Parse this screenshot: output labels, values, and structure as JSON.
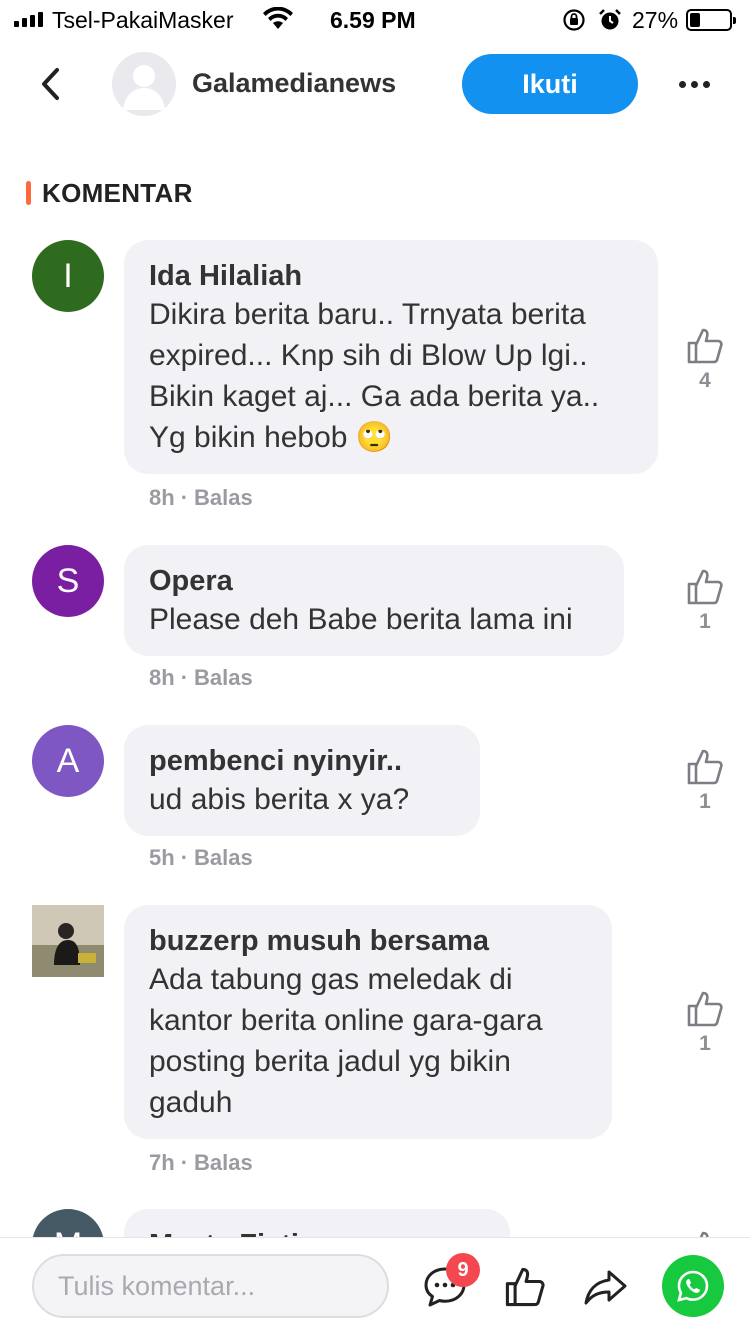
{
  "status_bar": {
    "carrier": "Tsel-PakaiMasker",
    "time": "6.59 PM",
    "battery_percent": "27%",
    "battery_level": 0.27,
    "icons": [
      "signal-icon",
      "wifi-icon",
      "rotation-lock-icon",
      "alarm-icon",
      "battery-icon"
    ]
  },
  "header": {
    "channel_name": "Galamedianews",
    "follow_label": "Ikuti",
    "icons": [
      "back-arrow-icon",
      "avatar-placeholder-icon",
      "more-icon"
    ]
  },
  "section": {
    "title": "KOMENTAR"
  },
  "comments": [
    {
      "initial": "I",
      "avatar_color": "#2e6b1f",
      "name": "Ida Hilaliah",
      "text": "Dikira berita baru.. Trnyata berita expired... Knp sih di Blow Up lgi.. Bikin kaget aj... Ga ada berita ya.. Yg bikin hebob 🙄",
      "time": "8h",
      "reply_label": "Balas",
      "likes": "4"
    },
    {
      "initial": "S",
      "avatar_color": "#7b1fa2",
      "name": "Opera",
      "text": "Please deh Babe berita lama ini",
      "time": "8h",
      "reply_label": "Balas",
      "likes": "1"
    },
    {
      "initial": "A",
      "avatar_color": "#7e57c2",
      "name": "pembenci nyinyir..",
      "text": "ud abis berita x ya?",
      "time": "5h",
      "reply_label": "Balas",
      "likes": "1"
    },
    {
      "initial": "",
      "avatar_color": "#d8d2c4",
      "name": "buzzerp musuh bersama",
      "text": "Ada tabung gas meledak di kantor berita online gara-gara posting berita jadul yg bikin gaduh",
      "time": "7h",
      "reply_label": "Balas",
      "likes": "1"
    },
    {
      "initial": "M",
      "avatar_color": "#455a64",
      "name": "Mayta Fiati",
      "text": "",
      "time": "",
      "reply_label": "",
      "likes": ""
    }
  ],
  "bottom_bar": {
    "input_placeholder": "Tulis komentar...",
    "comment_count_badge": "9",
    "icons": [
      "comment-icon",
      "like-icon",
      "share-icon",
      "whatsapp-icon"
    ],
    "whatsapp_color": "#17c93e"
  },
  "colors": {
    "accent": "#1391f0",
    "section_bar": "#ff6a3d",
    "bubble_bg": "#f2f2f6",
    "badge": "#f5474f"
  }
}
